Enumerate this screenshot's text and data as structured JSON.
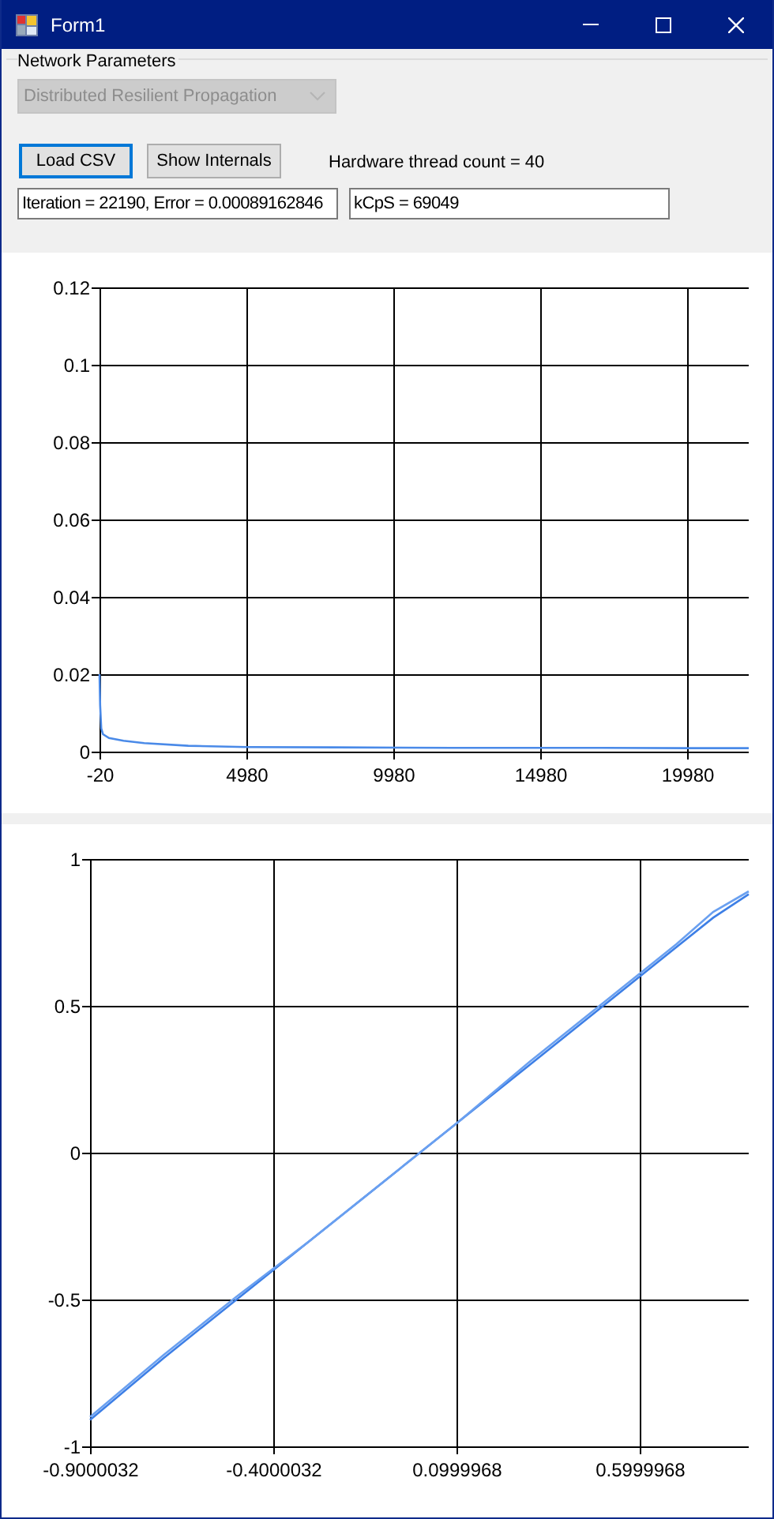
{
  "window": {
    "title": "Form1"
  },
  "network_parameters": {
    "label": "Network Parameters",
    "dropdown": {
      "value": "Distributed Resilient Propagation",
      "disabled": true
    }
  },
  "buttons": [
    {
      "label": "Load CSV",
      "focused": true
    },
    {
      "label": "Show Internals",
      "focused": false
    }
  ],
  "thread_count": "Hardware thread count = 40",
  "status_fields": [
    {
      "value": "Iteration = 22190, Error = 0.00089162846"
    },
    {
      "value": "kCpS = 69049"
    }
  ],
  "error_chart": {
    "chart_data": {
      "type": "line",
      "x": [
        -20,
        0,
        40,
        100,
        300,
        800,
        1500,
        3000,
        5000,
        8000,
        12000,
        16000,
        20000,
        22080
      ],
      "series": [
        {
          "color": "#4a8ae8",
          "values": [
            0.02,
            0.012,
            0.006,
            0.0045,
            0.0035,
            0.0028,
            0.0022,
            0.0015,
            0.0012,
            0.0011,
            0.001,
            0.001,
            0.0009,
            0.0009
          ]
        }
      ],
      "grid": true,
      "xlim": [
        -20,
        22080
      ],
      "ylim": [
        0,
        0.12
      ],
      "xticks": [
        -20,
        4980,
        9980,
        14980,
        19980
      ],
      "yticks": [
        0,
        0.02,
        0.04,
        0.06,
        0.08,
        0.1,
        0.12
      ]
    }
  },
  "fit_chart": {
    "chart_data": {
      "type": "line",
      "x": [
        -0.9,
        -0.7,
        -0.5,
        -0.3,
        -0.1,
        0.1,
        0.3,
        0.5,
        0.7,
        0.8,
        0.897
      ],
      "series": [
        {
          "color": "#3d7fe6",
          "values": [
            -0.91,
            -0.7,
            -0.5,
            -0.3,
            -0.1,
            0.1,
            0.3,
            0.5,
            0.7,
            0.8,
            0.88
          ]
        },
        {
          "color": "#6aa0f0",
          "values": [
            -0.9,
            -0.69,
            -0.49,
            -0.3,
            -0.1,
            0.1,
            0.31,
            0.51,
            0.71,
            0.82,
            0.89
          ]
        }
      ],
      "grid": true,
      "xlim": [
        -0.9000032,
        0.897
      ],
      "ylim": [
        -1,
        1
      ],
      "xticks": [
        -0.9000032,
        -0.4000032,
        0.0999968,
        0.5999968
      ],
      "yticks": [
        -1,
        -0.5,
        0,
        0.5,
        1
      ]
    }
  }
}
